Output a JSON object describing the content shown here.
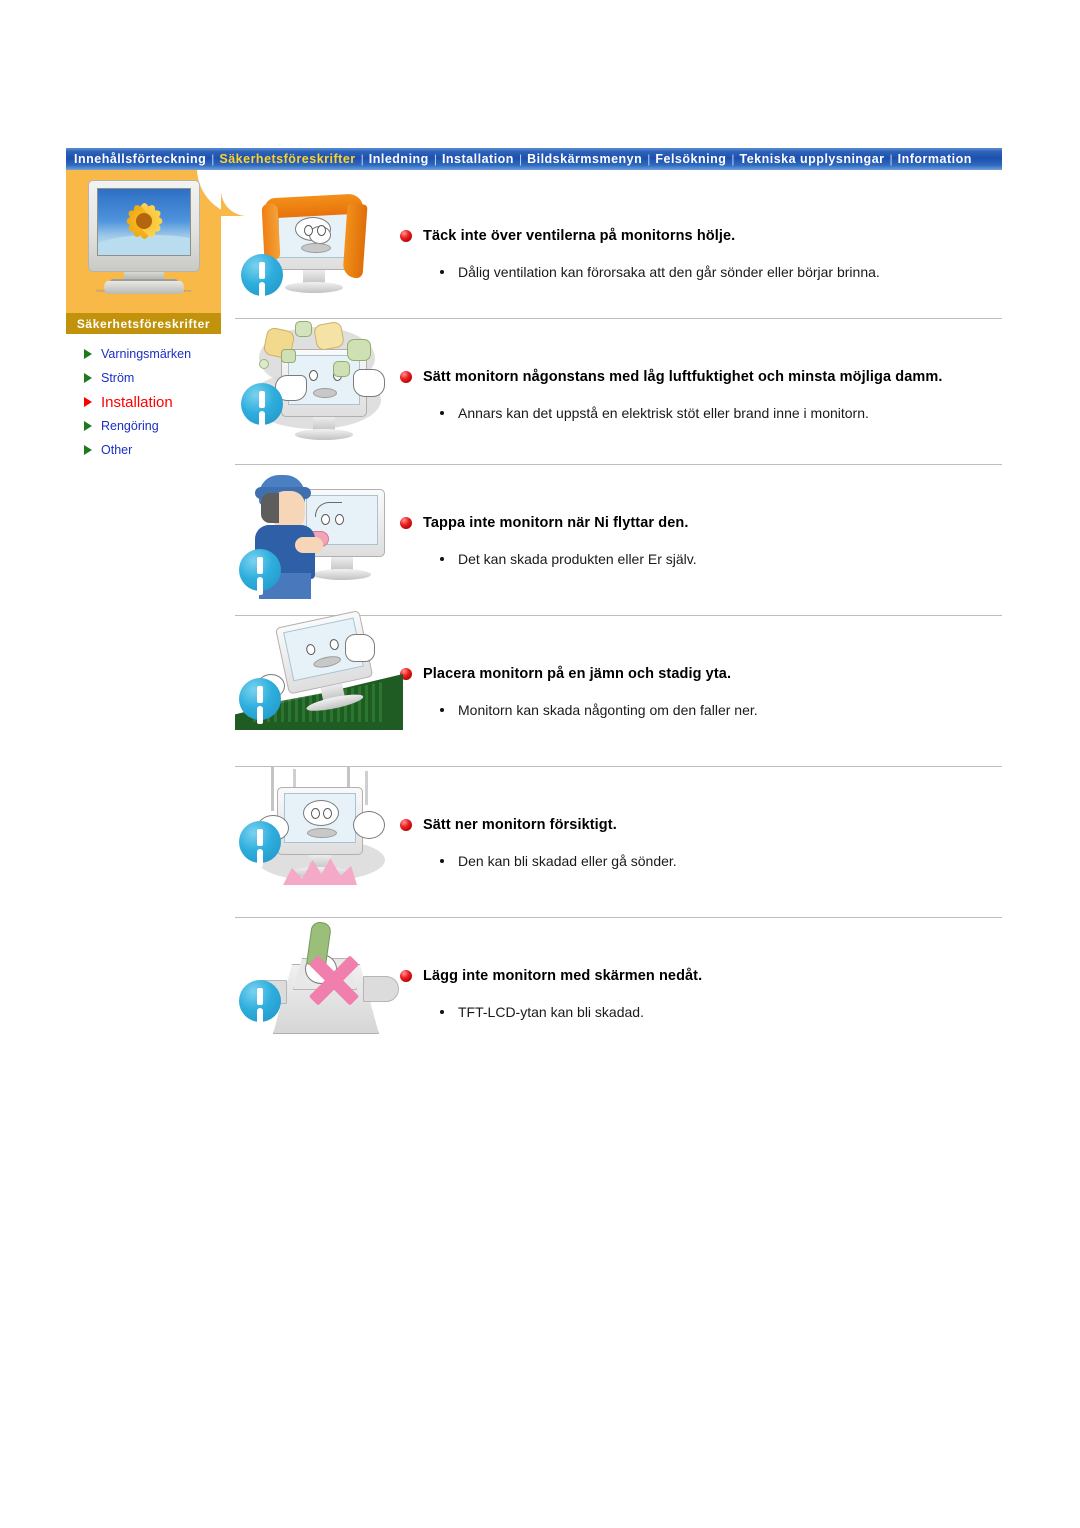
{
  "nav": {
    "items": [
      {
        "label": "Innehållsförteckning",
        "active": false
      },
      {
        "label": "Säkerhetsföreskrifter",
        "active": true
      },
      {
        "label": "Inledning",
        "active": false
      },
      {
        "label": "Installation",
        "active": false
      },
      {
        "label": "Bildskärmsmenyn",
        "active": false
      },
      {
        "label": "Felsökning",
        "active": false
      },
      {
        "label": "Tekniska upplysningar",
        "active": false
      },
      {
        "label": "Information",
        "active": false
      }
    ],
    "separator": "|"
  },
  "sidebar": {
    "banner": "Säkerhetsföreskrifter",
    "items": [
      {
        "label": "Varningsmärken",
        "active": false
      },
      {
        "label": "Ström",
        "active": false
      },
      {
        "label": "Installation",
        "active": true
      },
      {
        "label": "Rengöring",
        "active": false
      },
      {
        "label": "Other",
        "active": false
      }
    ]
  },
  "sections": [
    {
      "heading": "Täck inte över ventilerna på monitorns hölje.",
      "sub": "Dålig ventilation kan förorsaka att den går sönder eller börjar brinna.",
      "illustration": "monitor-covered-with-cloth"
    },
    {
      "heading": "Sätt monitorn någonstans med låg luftfuktighet och minsta möjliga damm.",
      "sub": "Annars kan det uppstå en elektrisk stöt eller brand inne i monitorn.",
      "illustration": "monitor-in-dust-cloud"
    },
    {
      "heading": "Tappa inte monitorn när Ni flyttar den.",
      "sub": "Det kan skada produkten eller Er själv.",
      "illustration": "person-carrying-monitor"
    },
    {
      "heading": "Placera monitorn på en jämn och stadig yta.",
      "sub": "Monitorn kan skada någonting om den faller ner.",
      "illustration": "monitor-on-slope"
    },
    {
      "heading": "Sätt ner monitorn försiktigt.",
      "sub": "Den kan bli skadad eller gå sönder.",
      "illustration": "monitor-dropped-hard"
    },
    {
      "heading": "Lägg inte monitorn med skärmen nedåt.",
      "sub": "TFT-LCD-ytan kan bli skadad.",
      "illustration": "monitor-face-down-crossed"
    }
  ],
  "colors": {
    "nav_bg": "#1d4fae",
    "nav_active_text": "#ffd42a",
    "sidebar_panel": "#f9b949",
    "sidebar_banner": "#c1930c",
    "link": "#1a2fc4",
    "link_active": "#ff0000",
    "heading": "#000000",
    "warn_badge": "#2eaedd",
    "bullet_sphere": "#ef2222"
  },
  "icons": {
    "warning_badge": "exclamation-circle-icon",
    "side_arrow": "triangle-right-icon",
    "heading_bullet": "red-sphere-bullet-icon"
  }
}
